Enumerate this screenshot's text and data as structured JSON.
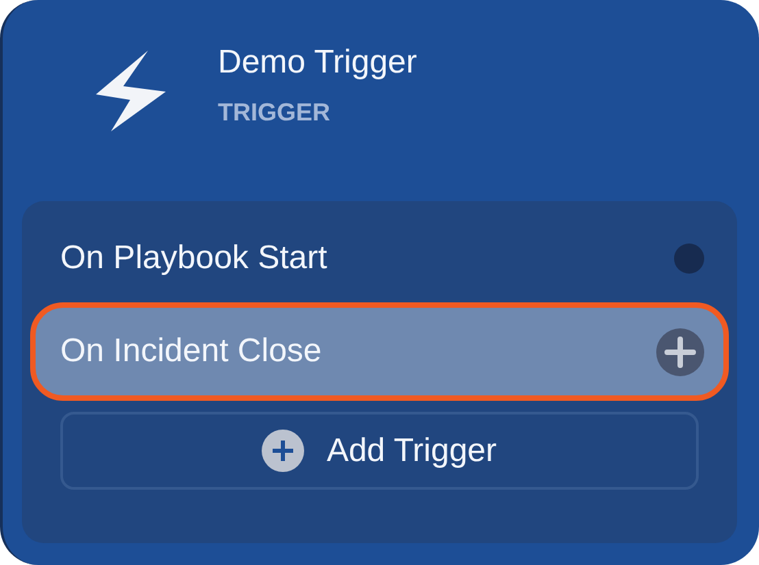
{
  "node": {
    "title": "Demo Trigger",
    "type_label": "TRIGGER"
  },
  "triggers": [
    {
      "label": "On Playbook Start",
      "kind": "dot",
      "selected": false
    },
    {
      "label": "On Incident Close",
      "kind": "add",
      "selected": true
    }
  ],
  "add_button": {
    "label": "Add Trigger"
  }
}
